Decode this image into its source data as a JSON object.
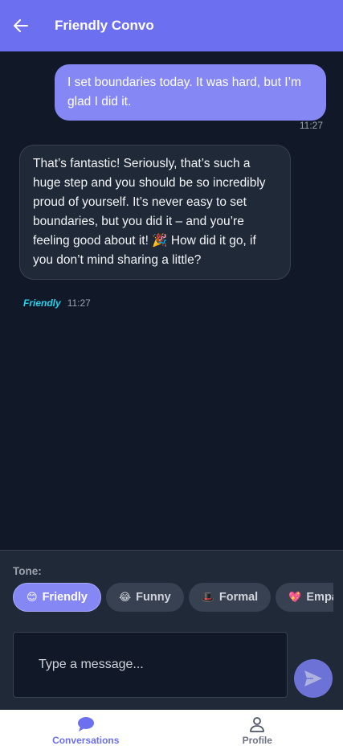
{
  "header": {
    "title": "Friendly Convo",
    "back_icon": "arrow-left-icon"
  },
  "messages": [
    {
      "sender": "user",
      "text": "I set boundaries today. It was hard, but I’m glad I did it.",
      "time": "11:27"
    },
    {
      "sender": "bot",
      "text": "That’s fantastic! Seriously, that’s such a huge step and you should be so incredibly proud of yourself. It’s never easy to set boundaries, but you did it – and you’re feeling good about it! 🎉 How did it go, if you don’t mind sharing a little?",
      "tone": "Friendly",
      "time": "11:27"
    }
  ],
  "composer": {
    "tone_label": "Tone:",
    "tones": [
      {
        "emoji": "😊",
        "label": "Friendly",
        "active": true
      },
      {
        "emoji": "😂",
        "label": "Funny",
        "active": false
      },
      {
        "emoji": "🎩",
        "label": "Formal",
        "active": false
      },
      {
        "emoji": "💖",
        "label": "Empathetic",
        "active": false
      }
    ],
    "placeholder": "Type a message...",
    "send_icon": "send-icon"
  },
  "nav": {
    "conversations": "Conversations",
    "profile": "Profile"
  },
  "colors": {
    "accent": "#6b6ff0",
    "user_bubble": "#8587f5",
    "bot_bubble": "#1f2937",
    "tone_tag": "#22d3ee",
    "background": "#111827"
  }
}
